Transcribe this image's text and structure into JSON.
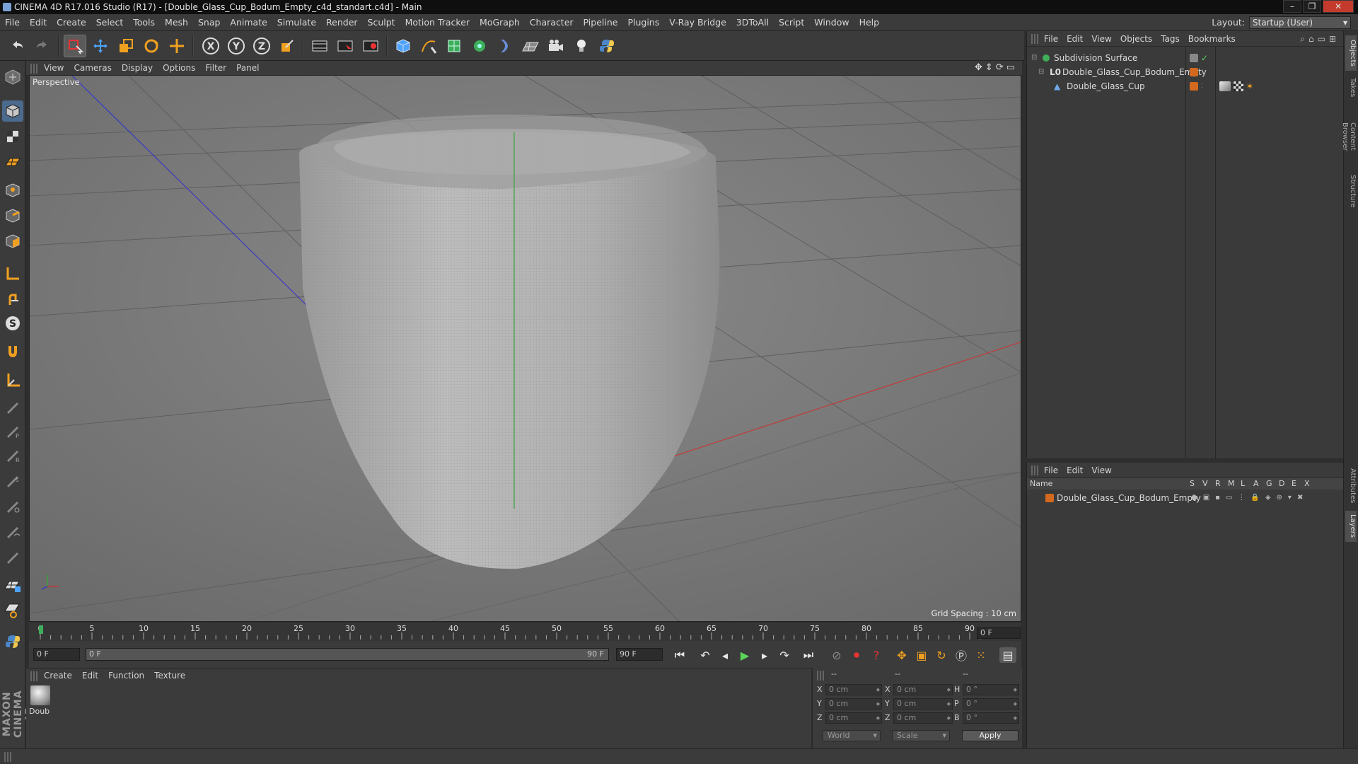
{
  "window": {
    "title": "CINEMA 4D R17.016 Studio (R17) - [Double_Glass_Cup_Bodum_Empty_c4d_standart.c4d] - Main",
    "controls": [
      "–",
      "❐",
      "✕"
    ]
  },
  "menubar": {
    "items": [
      "File",
      "Edit",
      "Create",
      "Select",
      "Tools",
      "Mesh",
      "Snap",
      "Animate",
      "Simulate",
      "Render",
      "Sculpt",
      "Motion Tracker",
      "MoGraph",
      "Character",
      "Pipeline",
      "Plugins",
      "V-Ray Bridge",
      "3DToAll",
      "Script",
      "Window",
      "Help"
    ],
    "layout_label": "Layout:",
    "layout_value": "Startup (User)"
  },
  "toolbar": {
    "icons": [
      "undo-icon",
      "redo-icon",
      "live-selection-icon",
      "move-icon",
      "scale-icon",
      "rotate-icon",
      "last-tool-icon",
      "x-axis-lock-icon",
      "y-axis-lock-icon",
      "z-axis-lock-icon",
      "coordinate-system-icon",
      "render-view-icon",
      "render-picture-viewer-icon",
      "edit-render-settings-icon",
      "cube-icon",
      "pen-spline-icon",
      "subdivision-surface-icon",
      "cloner-icon",
      "deformer-icon",
      "floor-icon",
      "camera-icon",
      "light-icon",
      "python-icon"
    ],
    "axis_labels": [
      "X",
      "Y",
      "Z"
    ]
  },
  "lefttools": {
    "icons": [
      "make-editable-icon",
      "model-mode-icon",
      "texture-mode-icon",
      "workplane-icon",
      "points-mode-icon",
      "edges-mode-icon",
      "polygons-mode-icon",
      "axis-mode-icon",
      "tweak-icon",
      "snap-icon",
      "magnet-icon",
      "workplane-axis-icon",
      "knife-icon",
      "loop-cut-icon",
      "bevel-icon",
      "extrude-icon",
      "sweep-icon",
      "brush-icon",
      "paint-icon",
      "lock-grid-icon",
      "gear-icon",
      "python-script-icon"
    ],
    "maxon_logo": "MAXON CINEMA 4D"
  },
  "viewport": {
    "menu": [
      "View",
      "Cameras",
      "Display",
      "Options",
      "Filter",
      "Panel"
    ],
    "label": "Perspective",
    "grid_spacing": "Grid Spacing : 10 cm"
  },
  "timeline": {
    "ticks": [
      "0",
      "5",
      "10",
      "15",
      "20",
      "25",
      "30",
      "35",
      "40",
      "45",
      "50",
      "55",
      "60",
      "65",
      "70",
      "75",
      "80",
      "85",
      "90"
    ],
    "frame_end_field": "0 F"
  },
  "transport": {
    "current_frame": "0 F",
    "range_start": "0 F",
    "range_end": "90 F",
    "max_frame": "90 F"
  },
  "material_manager": {
    "menu": [
      "Create",
      "Edit",
      "Function",
      "Texture"
    ],
    "materials": [
      {
        "name": "Doub"
      }
    ]
  },
  "coordinates": {
    "headers": [
      "--",
      "--",
      "--"
    ],
    "rows": [
      {
        "pos_label": "X",
        "pos": "0 cm",
        "size_label": "X",
        "size": "0 cm",
        "rot_label": "H",
        "rot": "0 °"
      },
      {
        "pos_label": "Y",
        "pos": "0 cm",
        "size_label": "Y",
        "size": "0 cm",
        "rot_label": "P",
        "rot": "0 °"
      },
      {
        "pos_label": "Z",
        "pos": "0 cm",
        "size_label": "Z",
        "size": "0 cm",
        "rot_label": "B",
        "rot": "0 °"
      }
    ],
    "mode": "World",
    "size_mode": "Scale",
    "apply": "Apply"
  },
  "object_manager": {
    "menu": [
      "File",
      "Edit",
      "View",
      "Objects",
      "Tags",
      "Bookmarks"
    ],
    "objects": [
      {
        "name": "Subdivision Surface",
        "depth": 0,
        "icon": "subdivision-surface-icon"
      },
      {
        "name": "Double_Glass_Cup_Bodum_Empty",
        "depth": 1,
        "icon": "null-object-icon"
      },
      {
        "name": "Double_Glass_Cup",
        "depth": 2,
        "icon": "polygon-object-icon"
      }
    ]
  },
  "layer_manager": {
    "menu": [
      "File",
      "Edit",
      "View"
    ],
    "columns": [
      "Name",
      "S",
      "V",
      "R",
      "M",
      "L",
      "A",
      "G",
      "D",
      "E",
      "X"
    ],
    "layers": [
      {
        "name": "Double_Glass_Cup_Bodum_Empty",
        "color": "#d2691e"
      }
    ]
  },
  "right_tabs": [
    "Objects",
    "Takes",
    "Content Browser",
    "Structure",
    "Attributes",
    "Layers"
  ],
  "colors": {
    "accent": "#4b6a8e",
    "x_axis": "#c23a3a",
    "y_axis": "#3aa33a",
    "z_axis": "#3a3ac2",
    "layer_orange": "#d2691e"
  }
}
